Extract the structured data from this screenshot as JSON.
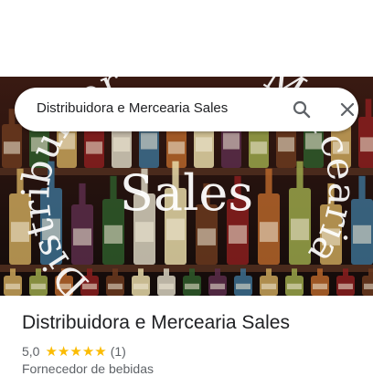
{
  "search": {
    "query": "Distribuidora e Mercearia Sales",
    "search_icon": "search-icon",
    "close_icon": "close-icon"
  },
  "hero": {
    "overlay_left": "Distribuidora",
    "overlay_right": "Mercearia",
    "overlay_center": "Sales"
  },
  "place": {
    "name": "Distribuidora e Mercearia Sales",
    "rating": "5,0",
    "stars": 5,
    "review_count": "(1)",
    "category": "Fornecedor de bebidas"
  },
  "colors": {
    "star": "#fbbc04",
    "text_primary": "#202124",
    "text_secondary": "#5f6368"
  }
}
